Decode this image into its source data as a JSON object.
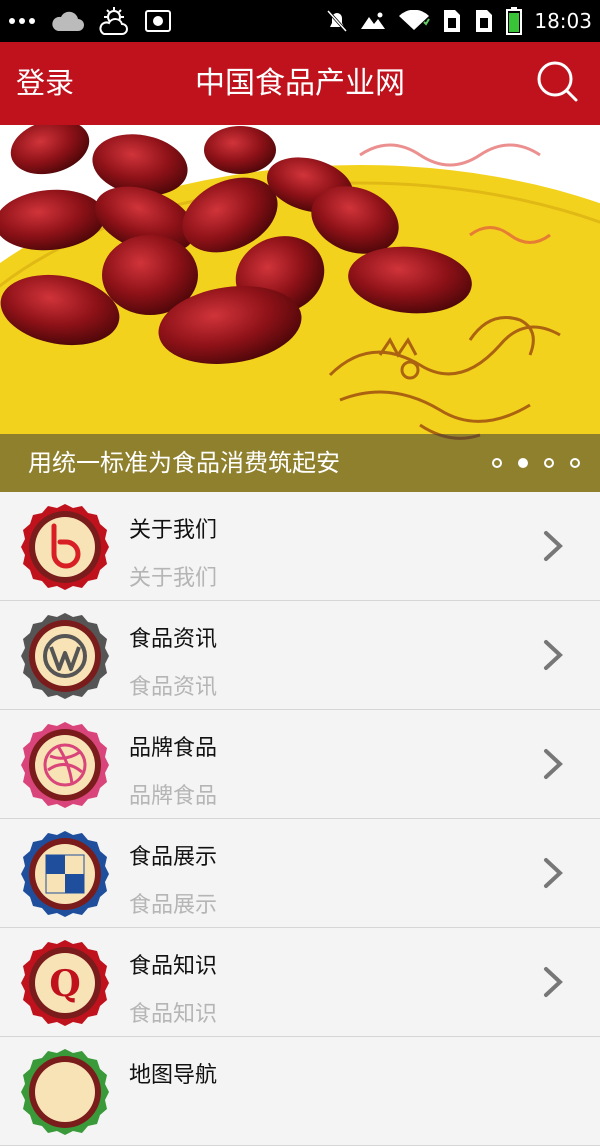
{
  "status_bar": {
    "time": "18:03",
    "left_icons": [
      "more-icon",
      "cloud-icon",
      "weather-sun-cloud-icon",
      "screenshot-icon"
    ],
    "right_icons": [
      "mute-icon",
      "photo-icon",
      "wifi-icon",
      "sim1-icon",
      "sim2-icon",
      "battery-icon"
    ]
  },
  "header": {
    "login_label": "登录",
    "title": "中国食品产业网",
    "search_icon": "search-icon",
    "bg_color": "#c0121d"
  },
  "banner": {
    "caption": "用统一标准为食品消费筑起安",
    "dots_total": 4,
    "active_dot": 2
  },
  "menu": {
    "items": [
      {
        "title": "关于我们",
        "subtitle": "关于我们",
        "icon": "b-logo-icon",
        "ring": "#c0121d"
      },
      {
        "title": "食品资讯",
        "subtitle": "食品资讯",
        "icon": "wordpress-icon",
        "ring": "#555555"
      },
      {
        "title": "品牌食品",
        "subtitle": "品牌食品",
        "icon": "dribbble-icon",
        "ring": "#d9457a"
      },
      {
        "title": "食品展示",
        "subtitle": "食品展示",
        "icon": "delicious-icon",
        "ring": "#1f4f9c"
      },
      {
        "title": "食品知识",
        "subtitle": "食品知识",
        "icon": "quora-icon",
        "ring": "#c0121d"
      },
      {
        "title": "地图导航",
        "subtitle": "",
        "icon": "map-icon",
        "ring": "#3a9a3a"
      }
    ]
  }
}
